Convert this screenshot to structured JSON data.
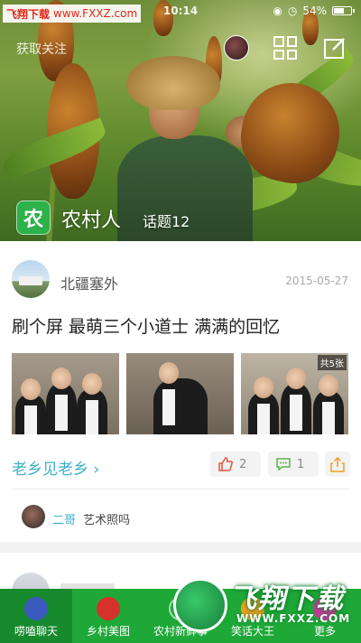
{
  "status_bar": {
    "time": "10:14",
    "battery": "54%"
  },
  "watermark": {
    "brand": "飞翔下载",
    "url": "www.FXXZ.com"
  },
  "hero": {
    "top_left_text": "获取关注",
    "group_badge": "农",
    "group_name": "农村人",
    "topic_count": "话题12"
  },
  "post": {
    "author": "北疆塞外",
    "date": "2015-05-27",
    "title": "刷个屏 最萌三个小道士 满满的回忆",
    "photo_count_badge": "共5张",
    "circle_link": "老乡见老乡 ›",
    "likes": "2",
    "comments": "1",
    "comment": {
      "user": "二哥",
      "text": "艺术照吗"
    }
  },
  "tabbar": {
    "tabs": [
      {
        "label": "唠嗑聊天",
        "icon": "chat-icon",
        "active": true
      },
      {
        "label": "乡村美图",
        "icon": "camera-icon",
        "active": false
      },
      {
        "label": "农村新鲜事",
        "icon": "news-icon",
        "active": false
      },
      {
        "label": "笑话大王",
        "icon": "smile-icon",
        "active": false
      },
      {
        "label": "更多",
        "icon": "more-icon",
        "active": false
      }
    ]
  },
  "overlay_logo": {
    "text": "飞翔下载",
    "url": "WWW.FXXZ.COM"
  },
  "colors": {
    "brand_green": "#1ea838",
    "link_cyan": "#3bb0c9",
    "badge_green": "#2db14a"
  }
}
